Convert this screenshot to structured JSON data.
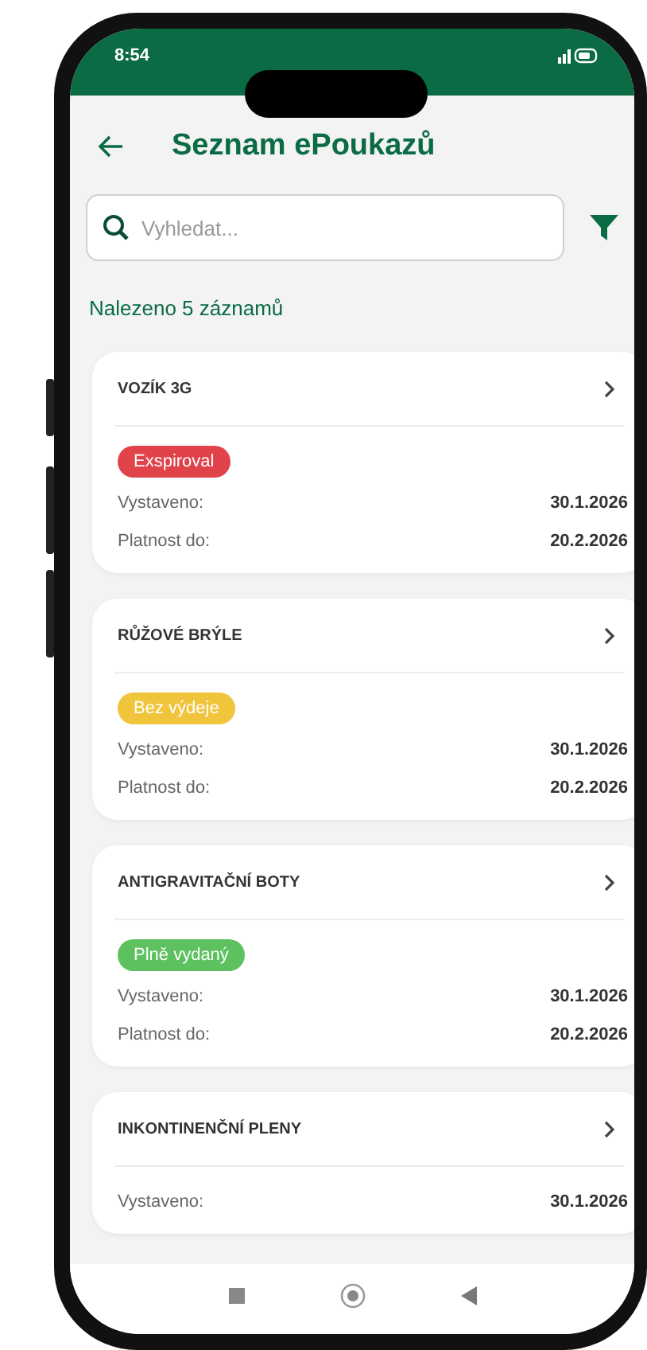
{
  "status_bar": {
    "time": "8:54"
  },
  "header": {
    "title": "Seznam ePoukazů"
  },
  "search": {
    "placeholder": "Vyhledat..."
  },
  "result_count": "Nalezeno 5 záznamů",
  "cards": [
    {
      "title": "VOZÍK 3G",
      "badge": {
        "text": "Exspiroval",
        "color": "#e0434a"
      },
      "rows": [
        {
          "label": "Vystaveno:",
          "value": "30.1.2026"
        },
        {
          "label": "Platnost do:",
          "value": "20.2.2026"
        }
      ]
    },
    {
      "title": "RŮŽOVÉ BRÝLE",
      "badge": {
        "text": "Bez výdeje",
        "color": "#f0c53c"
      },
      "rows": [
        {
          "label": "Vystaveno:",
          "value": "30.1.2026"
        },
        {
          "label": "Platnost do:",
          "value": "20.2.2026"
        }
      ]
    },
    {
      "title": "ANTIGRAVITAČNÍ BOTY",
      "badge": {
        "text": "Plně vydaný",
        "color": "#5cc15e"
      },
      "rows": [
        {
          "label": "Vystaveno:",
          "value": "30.1.2026"
        },
        {
          "label": "Platnost do:",
          "value": "20.2.2026"
        }
      ]
    },
    {
      "title": "INKONTINENČNÍ PLENY",
      "rows": [
        {
          "label": "Vystaveno:",
          "value": "30.1.2026"
        }
      ]
    }
  ]
}
